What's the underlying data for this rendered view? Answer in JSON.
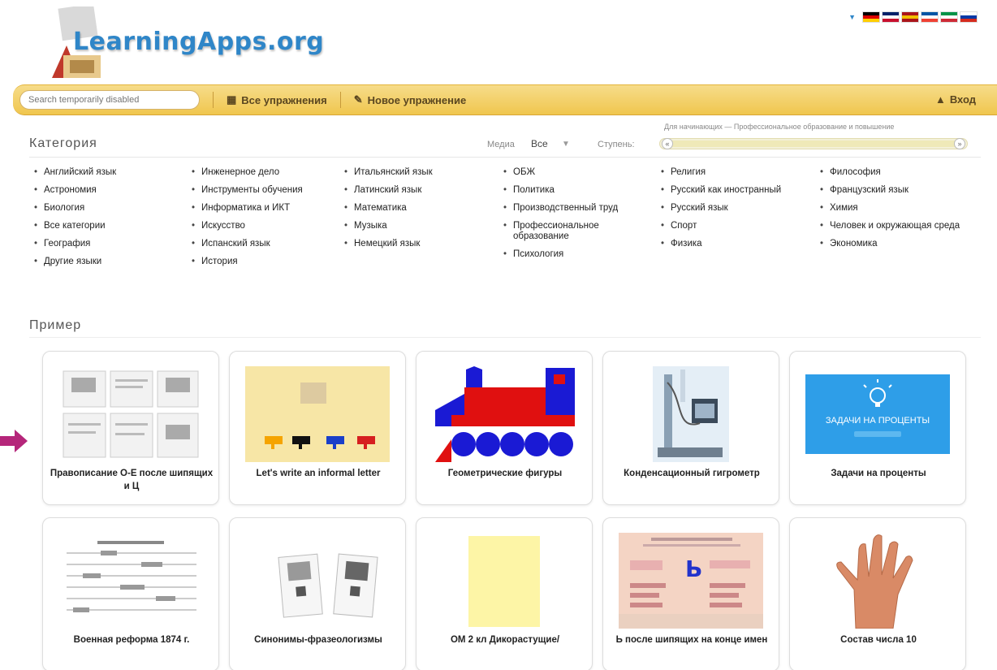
{
  "header": {
    "logo_text": "LearningApps.org"
  },
  "languages": {
    "caret": "▼",
    "flags": [
      {
        "name": "flag-de",
        "c1": "#000000",
        "c2": "#dd0000",
        "c3": "#ffce00"
      },
      {
        "name": "flag-uk",
        "c1": "#012169",
        "c2": "#ffffff",
        "c3": "#c8102e"
      },
      {
        "name": "flag-es",
        "c1": "#aa151b",
        "c2": "#f1bf00",
        "c3": "#aa151b"
      },
      {
        "name": "flag-fr",
        "c1": "#0055a4",
        "c2": "#ffffff",
        "c3": "#ef4135"
      },
      {
        "name": "flag-it",
        "c1": "#009246",
        "c2": "#ffffff",
        "c3": "#ce2b37"
      },
      {
        "name": "flag-ru",
        "c1": "#ffffff",
        "c2": "#0039a6",
        "c3": "#d52b1e"
      }
    ]
  },
  "nav": {
    "search_placeholder": "Search temporarily disabled",
    "all_exercises": "Все упражнения",
    "new_exercise": "Новое упражнение",
    "login": "Вход"
  },
  "filters": {
    "category_title": "Категория",
    "hint": "Для начинающих — Профессиональное образование и повышение",
    "media_label": "Медиа",
    "media_value": "Все",
    "level_label": "Ступень:"
  },
  "categories": {
    "col1": [
      "Английский язык",
      "Астрономия",
      "Биология",
      "Все категории",
      "География",
      "Другие языки"
    ],
    "col2": [
      "Инженерное дело",
      "Инструменты обучения",
      "Информатика и ИКТ",
      "Искусство",
      "Испанский язык",
      "История"
    ],
    "col3": [
      "Итальянский язык",
      "Латинский язык",
      "Математика",
      "Музыка",
      "Немецкий язык"
    ],
    "col4": [
      "ОБЖ",
      "Политика",
      "Производственный труд",
      "Профессиональное образование",
      "Психология"
    ],
    "col5": [
      "Религия",
      "Русский как иностранный",
      "Русский язык",
      "Спорт",
      "Физика"
    ],
    "col6": [
      "Философия",
      "Французский язык",
      "Химия",
      "Человек и окружающая среда",
      "Экономика"
    ]
  },
  "examples": {
    "title": "Пример",
    "cards": [
      {
        "label": "Правописание О-Е после шипящих и Ц"
      },
      {
        "label": "Let's write an informal letter"
      },
      {
        "label": "Геометрические фигуры"
      },
      {
        "label": "Конденсационный гигрометр"
      },
      {
        "label": "Задачи на проценты",
        "thumb_title": "ЗАДАЧИ НА ПРОЦЕНТЫ"
      },
      {
        "label": "Военная реформа 1874 г."
      },
      {
        "label": "Синонимы-фразеологизмы"
      },
      {
        "label": "ОМ 2 кл Дикорастущие/"
      },
      {
        "label": "Ь после шипящих на конце имен",
        "thumb_letter": "Ь"
      },
      {
        "label": "Состав числа 10"
      }
    ]
  },
  "colors": {
    "brand_blue": "#2f86c8",
    "nav_yellow": "#f0c64e",
    "arrow_magenta": "#b5267a"
  }
}
